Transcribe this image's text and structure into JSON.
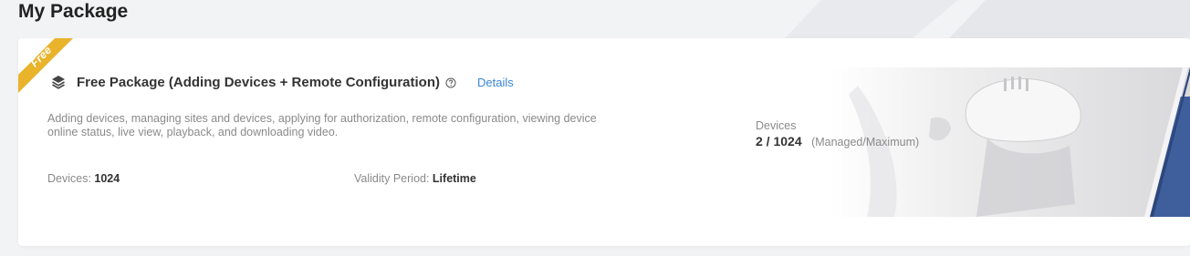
{
  "page": {
    "title": "My Package"
  },
  "package": {
    "ribbon_label": "Free",
    "title": "Free Package (Adding Devices + Remote Configuration)",
    "details_link": "Details",
    "description": "Adding devices, managing sites and devices, applying for authorization, remote configuration, viewing device online status, live view, playback, and downloading video.",
    "devices_label": "Devices: ",
    "devices_value": "1024",
    "validity_label": "Validity Period: ",
    "validity_value": "Lifetime",
    "usage": {
      "label": "Devices",
      "value": "2 / 1024",
      "hint": "(Managed/Maximum)"
    },
    "icons": {
      "package": "layers-icon",
      "help": "question-circle-icon"
    }
  },
  "colors": {
    "ribbon": "#e9b32b",
    "link": "#3b86d8",
    "banner_blue": "#3f5f9c"
  }
}
